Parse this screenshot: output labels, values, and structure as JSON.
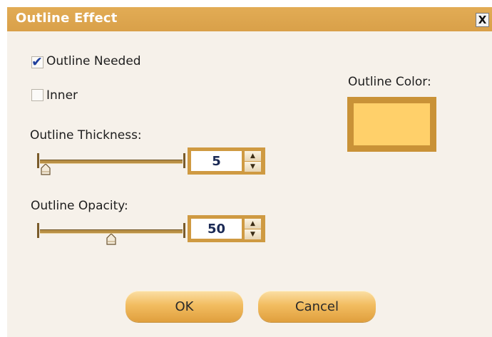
{
  "dialog": {
    "title": "Outline Effect",
    "close_label": "X"
  },
  "checkboxes": {
    "outline_needed": {
      "label": "Outline Needed",
      "checked": true
    },
    "inner": {
      "label": "Inner",
      "checked": false
    }
  },
  "thickness": {
    "label": "Outline Thickness:",
    "value": "5",
    "slider_level": 0.04
  },
  "opacity": {
    "label": "Outline Opacity:",
    "value": "50",
    "slider_level": 0.5
  },
  "color": {
    "label": "Outline Color:",
    "value": "#ffd06a"
  },
  "buttons": {
    "ok": "OK",
    "cancel": "Cancel"
  },
  "icons": {
    "spin_up": "▲",
    "spin_down": "▼",
    "checkmark": "✔"
  }
}
